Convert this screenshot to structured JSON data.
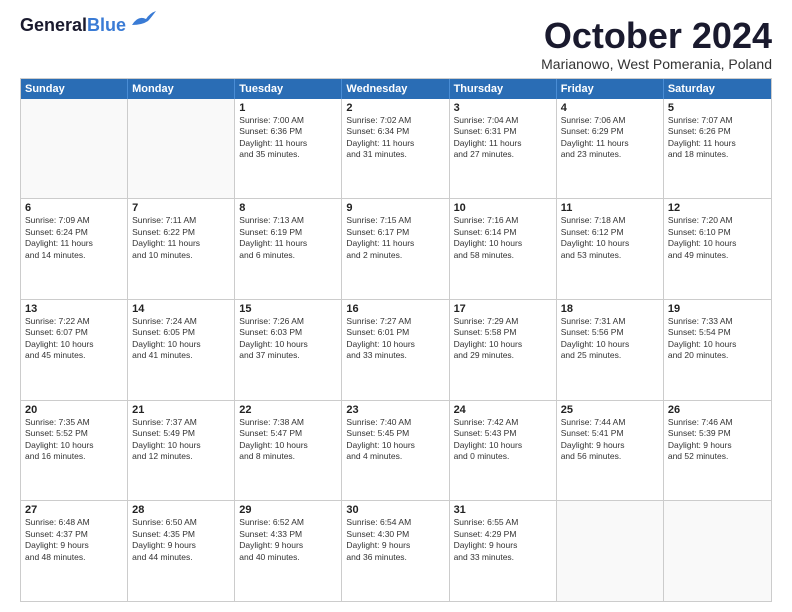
{
  "logo": {
    "line1": "General",
    "line2": "Blue"
  },
  "title": "October 2024",
  "subtitle": "Marianowo, West Pomerania, Poland",
  "header": {
    "days": [
      "Sunday",
      "Monday",
      "Tuesday",
      "Wednesday",
      "Thursday",
      "Friday",
      "Saturday"
    ]
  },
  "weeks": [
    [
      {
        "day": "",
        "info": ""
      },
      {
        "day": "",
        "info": ""
      },
      {
        "day": "1",
        "info": "Sunrise: 7:00 AM\nSunset: 6:36 PM\nDaylight: 11 hours\nand 35 minutes."
      },
      {
        "day": "2",
        "info": "Sunrise: 7:02 AM\nSunset: 6:34 PM\nDaylight: 11 hours\nand 31 minutes."
      },
      {
        "day": "3",
        "info": "Sunrise: 7:04 AM\nSunset: 6:31 PM\nDaylight: 11 hours\nand 27 minutes."
      },
      {
        "day": "4",
        "info": "Sunrise: 7:06 AM\nSunset: 6:29 PM\nDaylight: 11 hours\nand 23 minutes."
      },
      {
        "day": "5",
        "info": "Sunrise: 7:07 AM\nSunset: 6:26 PM\nDaylight: 11 hours\nand 18 minutes."
      }
    ],
    [
      {
        "day": "6",
        "info": "Sunrise: 7:09 AM\nSunset: 6:24 PM\nDaylight: 11 hours\nand 14 minutes."
      },
      {
        "day": "7",
        "info": "Sunrise: 7:11 AM\nSunset: 6:22 PM\nDaylight: 11 hours\nand 10 minutes."
      },
      {
        "day": "8",
        "info": "Sunrise: 7:13 AM\nSunset: 6:19 PM\nDaylight: 11 hours\nand 6 minutes."
      },
      {
        "day": "9",
        "info": "Sunrise: 7:15 AM\nSunset: 6:17 PM\nDaylight: 11 hours\nand 2 minutes."
      },
      {
        "day": "10",
        "info": "Sunrise: 7:16 AM\nSunset: 6:14 PM\nDaylight: 10 hours\nand 58 minutes."
      },
      {
        "day": "11",
        "info": "Sunrise: 7:18 AM\nSunset: 6:12 PM\nDaylight: 10 hours\nand 53 minutes."
      },
      {
        "day": "12",
        "info": "Sunrise: 7:20 AM\nSunset: 6:10 PM\nDaylight: 10 hours\nand 49 minutes."
      }
    ],
    [
      {
        "day": "13",
        "info": "Sunrise: 7:22 AM\nSunset: 6:07 PM\nDaylight: 10 hours\nand 45 minutes."
      },
      {
        "day": "14",
        "info": "Sunrise: 7:24 AM\nSunset: 6:05 PM\nDaylight: 10 hours\nand 41 minutes."
      },
      {
        "day": "15",
        "info": "Sunrise: 7:26 AM\nSunset: 6:03 PM\nDaylight: 10 hours\nand 37 minutes."
      },
      {
        "day": "16",
        "info": "Sunrise: 7:27 AM\nSunset: 6:01 PM\nDaylight: 10 hours\nand 33 minutes."
      },
      {
        "day": "17",
        "info": "Sunrise: 7:29 AM\nSunset: 5:58 PM\nDaylight: 10 hours\nand 29 minutes."
      },
      {
        "day": "18",
        "info": "Sunrise: 7:31 AM\nSunset: 5:56 PM\nDaylight: 10 hours\nand 25 minutes."
      },
      {
        "day": "19",
        "info": "Sunrise: 7:33 AM\nSunset: 5:54 PM\nDaylight: 10 hours\nand 20 minutes."
      }
    ],
    [
      {
        "day": "20",
        "info": "Sunrise: 7:35 AM\nSunset: 5:52 PM\nDaylight: 10 hours\nand 16 minutes."
      },
      {
        "day": "21",
        "info": "Sunrise: 7:37 AM\nSunset: 5:49 PM\nDaylight: 10 hours\nand 12 minutes."
      },
      {
        "day": "22",
        "info": "Sunrise: 7:38 AM\nSunset: 5:47 PM\nDaylight: 10 hours\nand 8 minutes."
      },
      {
        "day": "23",
        "info": "Sunrise: 7:40 AM\nSunset: 5:45 PM\nDaylight: 10 hours\nand 4 minutes."
      },
      {
        "day": "24",
        "info": "Sunrise: 7:42 AM\nSunset: 5:43 PM\nDaylight: 10 hours\nand 0 minutes."
      },
      {
        "day": "25",
        "info": "Sunrise: 7:44 AM\nSunset: 5:41 PM\nDaylight: 9 hours\nand 56 minutes."
      },
      {
        "day": "26",
        "info": "Sunrise: 7:46 AM\nSunset: 5:39 PM\nDaylight: 9 hours\nand 52 minutes."
      }
    ],
    [
      {
        "day": "27",
        "info": "Sunrise: 6:48 AM\nSunset: 4:37 PM\nDaylight: 9 hours\nand 48 minutes."
      },
      {
        "day": "28",
        "info": "Sunrise: 6:50 AM\nSunset: 4:35 PM\nDaylight: 9 hours\nand 44 minutes."
      },
      {
        "day": "29",
        "info": "Sunrise: 6:52 AM\nSunset: 4:33 PM\nDaylight: 9 hours\nand 40 minutes."
      },
      {
        "day": "30",
        "info": "Sunrise: 6:54 AM\nSunset: 4:30 PM\nDaylight: 9 hours\nand 36 minutes."
      },
      {
        "day": "31",
        "info": "Sunrise: 6:55 AM\nSunset: 4:29 PM\nDaylight: 9 hours\nand 33 minutes."
      },
      {
        "day": "",
        "info": ""
      },
      {
        "day": "",
        "info": ""
      }
    ]
  ]
}
